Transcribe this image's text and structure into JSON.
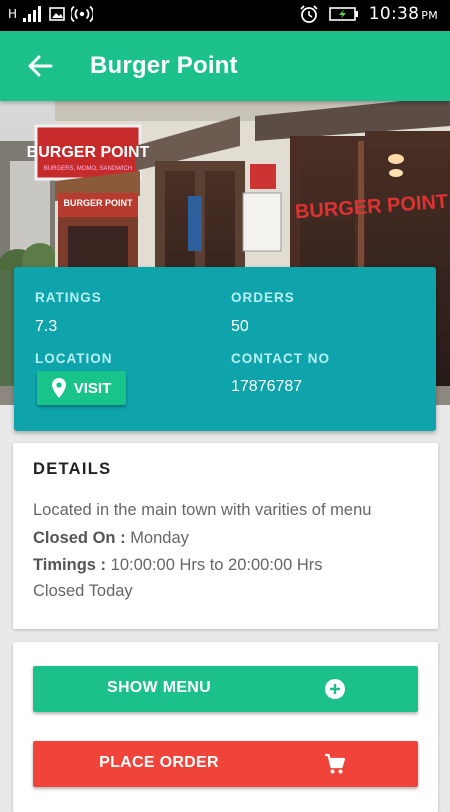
{
  "status_bar": {
    "time": "10:38",
    "ampm": "PM",
    "network": "H"
  },
  "app_bar": {
    "title": "Burger Point"
  },
  "hero": {
    "sign_main": "BURGER POINT",
    "sign_sub": "BURGERS, MOMO, SANDWICH",
    "window_text": "BURGER POINT"
  },
  "info": {
    "ratings_label": "RATINGS",
    "ratings_value": "7.3",
    "orders_label": "ORDERS",
    "orders_value": "50",
    "location_label": "LOCATION",
    "visit_label": "VISIT",
    "contact_label": "CONTACT NO",
    "contact_value": "17876787"
  },
  "details": {
    "title": "DETAILS",
    "description": "Located in the main town with varities of menu",
    "closed_on_label": "Closed On :",
    "closed_on_value": "Monday",
    "timings_label": "Timings :",
    "timings_value": "10:00:00 Hrs to 20:00:00 Hrs",
    "status": "Closed Today"
  },
  "actions": {
    "show_menu_label": "SHOW MENU",
    "place_order_label": "PLACE ORDER"
  },
  "colors": {
    "primary": "#1cc08a",
    "info_card": "#0fa3ac",
    "order": "#f0443a"
  }
}
